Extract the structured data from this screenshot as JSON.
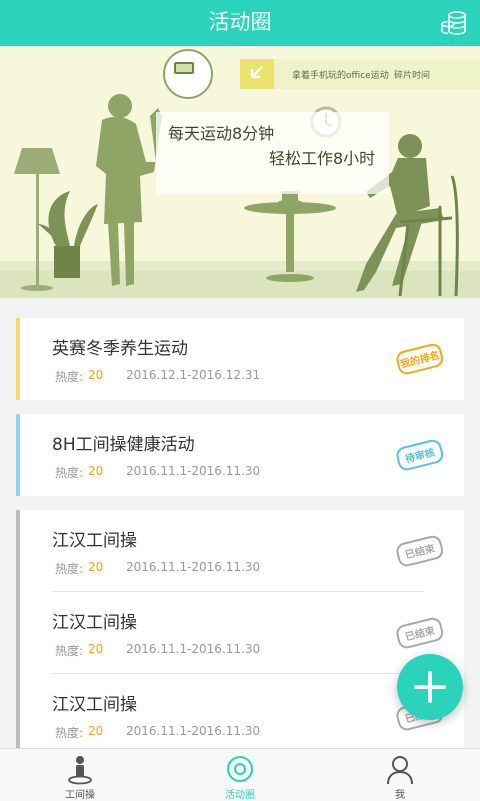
{
  "header": {
    "title": "活动圈",
    "right_icon": "coins-icon"
  },
  "banner": {
    "ticker_text_1": "拿着手机玩的office运动",
    "ticker_text_2": "碎片时间",
    "slogan_line1": "每天运动8分钟",
    "slogan_line2": "轻松工作8小时"
  },
  "activities": [
    {
      "name": "英赛冬季养生运动",
      "heat_label": "热度:",
      "heat": "20",
      "date": "2016.12.1-2016.12.31",
      "status": "我的排名",
      "accent": "#f5d86a"
    },
    {
      "name": "8H工间操健康活动",
      "heat_label": "热度:",
      "heat": "20",
      "date": "2016.11.1-2016.11.30",
      "status": "待审核",
      "accent": "#8fd6ee"
    },
    {
      "name": "江汉工间操",
      "heat_label": "热度:",
      "heat": "20",
      "date": "2016.11.1-2016.11.30",
      "status": "已结束",
      "accent": "#bdbdbd"
    },
    {
      "name": "江汉工间操",
      "heat_label": "热度:",
      "heat": "20",
      "date": "2016.11.1-2016.11.30",
      "status": "已结束",
      "accent": "#bdbdbd"
    },
    {
      "name": "江汉工间操",
      "heat_label": "热度:",
      "heat": "20",
      "date": "2016.11.1-2016.11.30",
      "status": "已结束",
      "accent": "#bdbdbd"
    }
  ],
  "nav": {
    "tabs": [
      {
        "label": "工间操",
        "icon": "exercise-person-icon",
        "active": false
      },
      {
        "label": "活动圈",
        "icon": "activity-circle-icon",
        "active": true
      },
      {
        "label": "我",
        "icon": "user-profile-icon",
        "active": false
      }
    ]
  },
  "colors": {
    "accent": "#2ad3ba",
    "heat": "#f0a81e"
  }
}
